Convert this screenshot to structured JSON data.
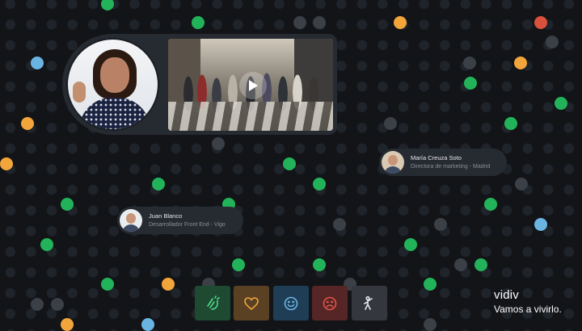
{
  "colors": {
    "background": "#121418",
    "dot_idle": "#1f232a",
    "dot_gray": "#3b3f46",
    "green": "#22b35a",
    "orange": "#f2a53a",
    "blue": "#6ab4e2",
    "red": "#d9503c",
    "panel": "#262a31"
  },
  "video_call": {
    "presenter_icon": "presenter-video-tile",
    "scene_icon": "shared-video-thumbnail",
    "play_icon": "play-icon"
  },
  "participants": [
    {
      "name": "María Creuza Soto",
      "role": "Directora de marketing - Madrid"
    },
    {
      "name": "Juan Blanco",
      "role": "Desarrollador Front End - Vigo"
    }
  ],
  "reactions": [
    {
      "icon": "clapping-hands-icon",
      "color": "#4fd68a"
    },
    {
      "icon": "heart-icon",
      "color": "#f2a53a"
    },
    {
      "icon": "smile-icon",
      "color": "#6ab4e2"
    },
    {
      "icon": "sad-face-icon",
      "color": "#e0564a"
    },
    {
      "icon": "raised-hand-icon",
      "color": "#e6e8eb"
    }
  ],
  "brand": {
    "name": "vidiv",
    "tagline": "Vamos a vivirlo."
  }
}
